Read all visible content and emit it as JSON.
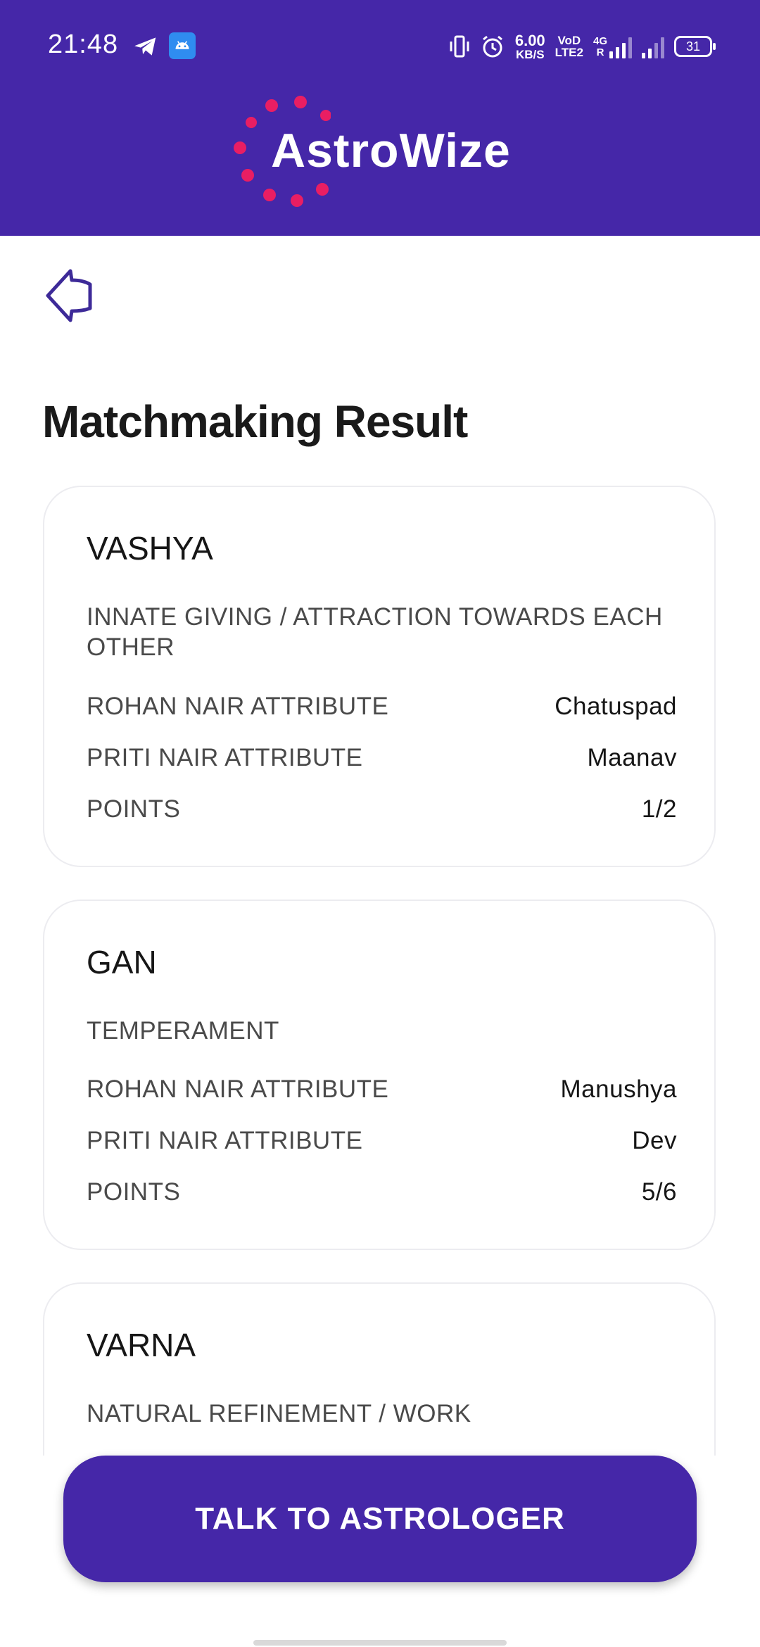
{
  "status_bar": {
    "time": "21:48",
    "speed_value": "6.00",
    "speed_unit": "KB/S",
    "volte": "VoD",
    "lte": "LTE2",
    "network_4g": "4G",
    "network_r": "R",
    "battery": "31"
  },
  "brand": {
    "name": "AstroWize",
    "dot_color": "#e91e63",
    "primary": "#4527a8"
  },
  "page": {
    "title": "Matchmaking Result"
  },
  "cards": [
    {
      "title": "VASHYA",
      "subtitle": "INNATE GIVING / ATTRACTION  TOWARDS EACH OTHER",
      "rows": [
        {
          "label": "ROHAN NAIR ATTRIBUTE",
          "value": "Chatuspad"
        },
        {
          "label": "PRITI NAIR ATTRIBUTE",
          "value": "Maanav"
        },
        {
          "label": "POINTS",
          "value": "1/2"
        }
      ]
    },
    {
      "title": "GAN",
      "subtitle": "TEMPERAMENT",
      "rows": [
        {
          "label": "ROHAN NAIR ATTRIBUTE",
          "value": "Manushya"
        },
        {
          "label": "PRITI NAIR ATTRIBUTE",
          "value": "Dev"
        },
        {
          "label": "POINTS",
          "value": "5/6"
        }
      ]
    },
    {
      "title": "VARNA",
      "subtitle": "NATURAL REFINEMENT  / WORK",
      "rows": []
    }
  ],
  "cta": {
    "label": "TALK TO ASTROLOGER"
  }
}
